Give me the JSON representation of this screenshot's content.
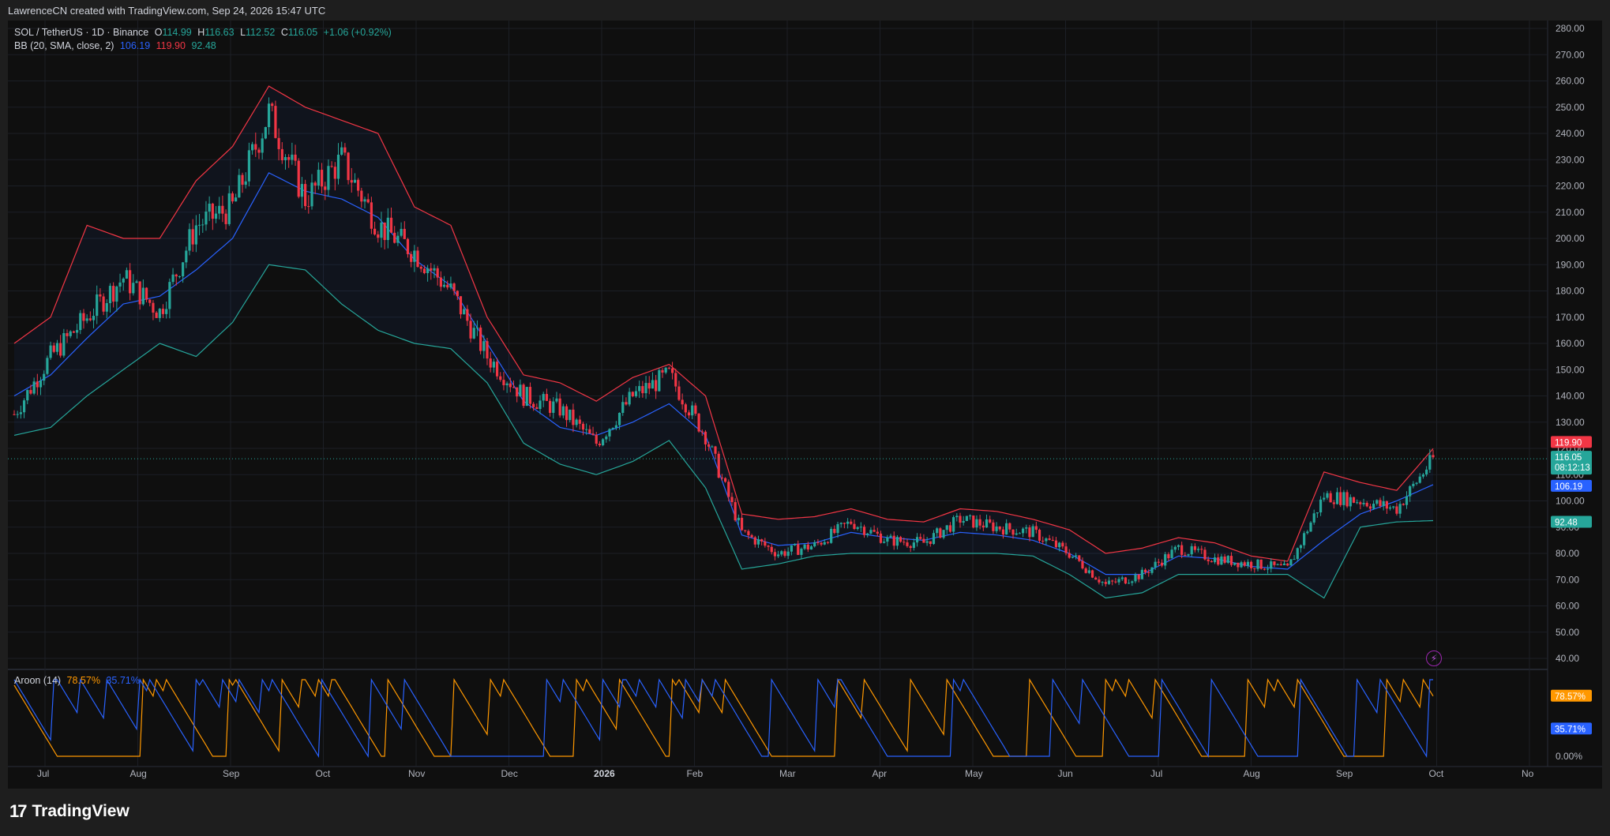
{
  "credit": "LawrenceCN created with TradingView.com, Sep 24, 2026 15:47 UTC",
  "brand": "TradingView",
  "colors": {
    "bg": "#0f0f0f",
    "up": "#26a69a",
    "down": "#f23645",
    "bb_basis": "#2962ff",
    "bb_upper": "#f23645",
    "bb_lower": "#26a69a",
    "aroon_up": "#ff9800",
    "aroon_down": "#2962ff"
  },
  "legend": {
    "symbol": "SOL / TetherUS · 1D · Binance",
    "o_label": "O",
    "o": "114.99",
    "h_label": "H",
    "h": "116.63",
    "l_label": "L",
    "l": "112.52",
    "c_label": "C",
    "c": "116.05",
    "change": "+1.06 (+0.92%)",
    "bb_label": "BB (20, SMA, close, 2)",
    "bb_basis": "106.19",
    "bb_upper": "119.90",
    "bb_lower": "92.48",
    "aroon_label": "Aroon (14)",
    "aroon_up": "78.57%",
    "aroon_down": "35.71%"
  },
  "icons": {
    "alert": "lightning-bolt-icon",
    "logo": "tradingview-logo-icon"
  },
  "chart_data": [
    {
      "type": "candlestick",
      "name": "SOL / TetherUS · 1D · Binance",
      "y_axis": {
        "position": "right",
        "ylim": [
          40,
          280
        ],
        "ticks": [
          "40.00",
          "50.00",
          "60.00",
          "70.00",
          "80.00",
          "90.00",
          "100.00",
          "110.00",
          "120.00",
          "130.00",
          "140.00",
          "150.00",
          "160.00",
          "170.00",
          "180.00",
          "190.00",
          "200.00",
          "210.00",
          "220.00",
          "230.00",
          "240.00",
          "250.00",
          "260.00",
          "270.00",
          "280.00"
        ]
      },
      "x_axis": {
        "labels": [
          "Jul",
          "Aug",
          "Sep",
          "Oct",
          "Nov",
          "Dec",
          "2026",
          "Feb",
          "Mar",
          "Apr",
          "May",
          "Jun",
          "Jul",
          "Aug",
          "Sep",
          "Oct",
          "No"
        ]
      },
      "grid": true,
      "price_series": {
        "x": [
          "Jul 1",
          "Jul 15",
          "Aug 1",
          "Aug 10",
          "Aug 20",
          "Sep 1",
          "Sep 10",
          "Sep 18",
          "Sep 25",
          "Oct 1",
          "Oct 10",
          "Oct 20",
          "Nov 1",
          "Nov 10",
          "Nov 20",
          "Dec 1",
          "Dec 15",
          "Jan 1",
          "Jan 15",
          "Feb 1",
          "Feb 10",
          "Feb 20",
          "Mar 1",
          "Mar 15",
          "Apr 1",
          "Apr 15",
          "May 1",
          "May 10",
          "May 20",
          "Jun 1",
          "Jun 10",
          "Jun 20",
          "Jul 1",
          "Jul 15",
          "Aug 1",
          "Aug 15",
          "Sep 1",
          "Sep 10",
          "Sep 20",
          "Sep 24"
        ],
        "close": [
          133,
          155,
          170,
          185,
          172,
          205,
          212,
          248,
          215,
          230,
          205,
          195,
          180,
          155,
          140,
          135,
          122,
          140,
          148,
          125,
          88,
          80,
          83,
          92,
          85,
          84,
          93,
          90,
          88,
          80,
          68,
          72,
          82,
          78,
          76,
          74,
          102,
          100,
          97,
          116.05
        ]
      },
      "bollinger": {
        "label": "BB (20, SMA, close, 2)",
        "upper": [
          160,
          170,
          205,
          200,
          200,
          222,
          235,
          258,
          250,
          245,
          240,
          212,
          205,
          170,
          148,
          145,
          138,
          147,
          152,
          140,
          95,
          93,
          94,
          97,
          93,
          92,
          97,
          96,
          93,
          89,
          80,
          82,
          86,
          84,
          79,
          77,
          111,
          107,
          104,
          119.9
        ],
        "basis": [
          140,
          148,
          162,
          175,
          178,
          188,
          200,
          225,
          218,
          215,
          208,
          192,
          182,
          160,
          138,
          128,
          125,
          130,
          137,
          125,
          87,
          83,
          84,
          88,
          86,
          85,
          88,
          87,
          85,
          80,
          72,
          72,
          79,
          78,
          75,
          74,
          85,
          95,
          100,
          106.19
        ],
        "lower": [
          125,
          128,
          140,
          150,
          160,
          155,
          168,
          190,
          188,
          175,
          165,
          160,
          158,
          145,
          122,
          114,
          110,
          115,
          123,
          105,
          74,
          76,
          79,
          80,
          80,
          80,
          80,
          80,
          79,
          72,
          63,
          65,
          72,
          72,
          72,
          72,
          63,
          90,
          92,
          92.48
        ]
      },
      "price_labels": [
        "119.90",
        "116.05",
        "08:12:13",
        "106.19",
        "92.48"
      ]
    },
    {
      "type": "line",
      "name": "Aroon (14)",
      "y_axis": {
        "ylim": [
          0,
          100
        ],
        "ticks": [
          "0.00%"
        ]
      },
      "series": [
        {
          "name": "Aroon Up",
          "last": 78.57
        },
        {
          "name": "Aroon Down",
          "last": 35.71
        }
      ],
      "price_labels": [
        "78.57%",
        "35.71%"
      ]
    }
  ]
}
